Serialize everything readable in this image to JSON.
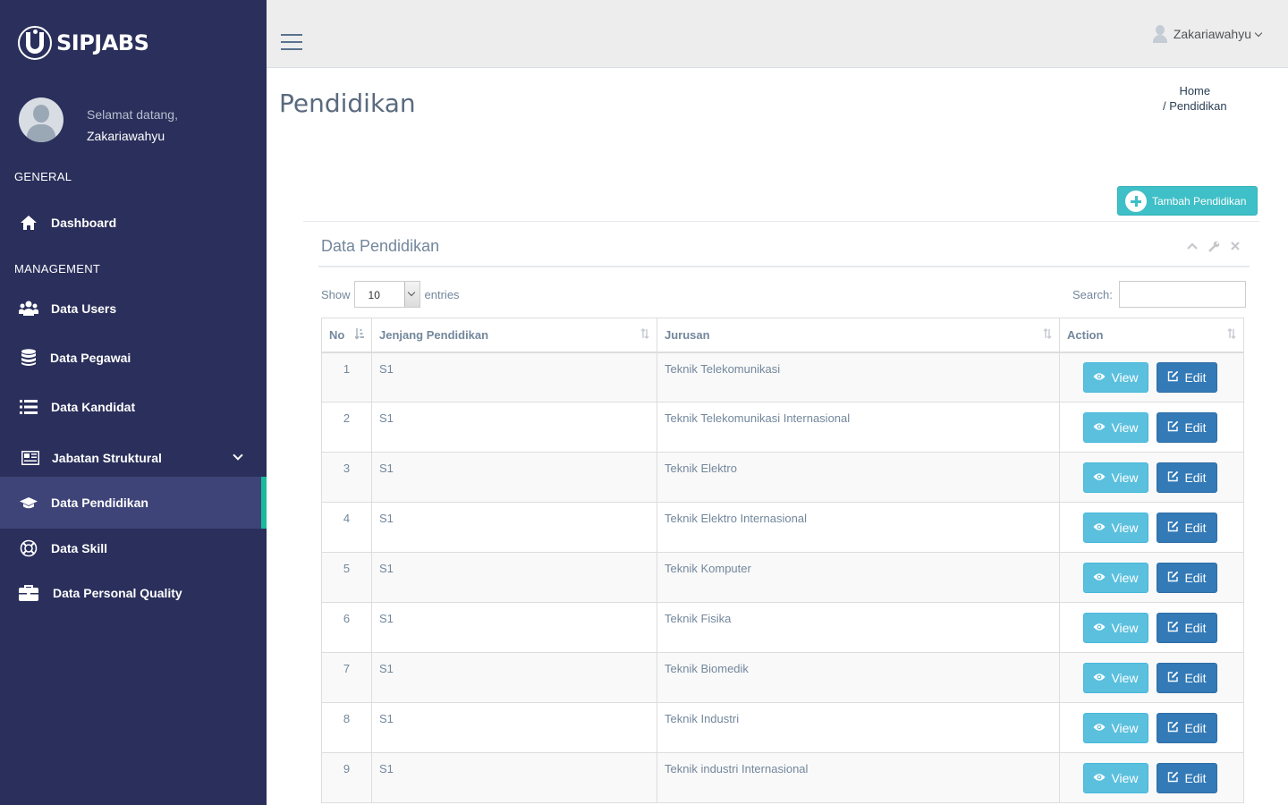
{
  "brand": {
    "name": "SIPJABS"
  },
  "profile": {
    "welcome": "Selamat datang,",
    "username": "Zakariawahyu"
  },
  "sidebar": {
    "sections": {
      "general": "GENERAL",
      "management": "MANAGEMENT"
    },
    "items": [
      {
        "label": "Dashboard",
        "icon": "home-icon"
      },
      {
        "label": "Data Users",
        "icon": "users-icon"
      },
      {
        "label": "Data Pegawai",
        "icon": "database-icon"
      },
      {
        "label": "Data Kandidat",
        "icon": "list-icon"
      },
      {
        "label": "Jabatan Struktural",
        "icon": "newspaper-icon"
      },
      {
        "label": "Data Pendidikan",
        "icon": "graduation-cap-icon",
        "active": true
      },
      {
        "label": "Data Skill",
        "icon": "life-ring-icon"
      },
      {
        "label": "Data Personal Quality",
        "icon": "briefcase-icon"
      }
    ]
  },
  "topnav": {
    "user": "Zakariawahyu"
  },
  "page": {
    "title": "Pendidikan"
  },
  "breadcrumb": {
    "home": "Home",
    "current": "/ Pendidikan"
  },
  "add_button": {
    "label": "Tambah Pendidikan"
  },
  "panel": {
    "title": "Data Pendidikan"
  },
  "table_controls": {
    "show": "Show",
    "entries_value": "10",
    "entries": "entries",
    "search_label": "Search:"
  },
  "table": {
    "headers": [
      "No",
      "Jenjang Pendidikan",
      "Jurusan",
      "Action"
    ],
    "rows": [
      {
        "no": "1",
        "jenjang": "S1",
        "jurusan": "Teknik Telekomunikasi"
      },
      {
        "no": "2",
        "jenjang": "S1",
        "jurusan": "Teknik Telekomunikasi Internasional"
      },
      {
        "no": "3",
        "jenjang": "S1",
        "jurusan": "Teknik Elektro"
      },
      {
        "no": "4",
        "jenjang": "S1",
        "jurusan": "Teknik Elektro Internasional"
      },
      {
        "no": "5",
        "jenjang": "S1",
        "jurusan": "Teknik Komputer"
      },
      {
        "no": "6",
        "jenjang": "S1",
        "jurusan": "Teknik Fisika"
      },
      {
        "no": "7",
        "jenjang": "S1",
        "jurusan": "Teknik Biomedik"
      },
      {
        "no": "8",
        "jenjang": "S1",
        "jurusan": "Teknik Industri"
      },
      {
        "no": "9",
        "jenjang": "S1",
        "jurusan": "Teknik industri Internasional"
      }
    ],
    "view_label": "View",
    "edit_label": "Edit"
  },
  "colors": {
    "sidebar": "#2a2f5b",
    "active_item": "#3e4478",
    "active_border": "#1abb9c",
    "view_btn": "#5bc0de",
    "edit_btn": "#337ab7",
    "add_btn": "#3fbfc7"
  }
}
